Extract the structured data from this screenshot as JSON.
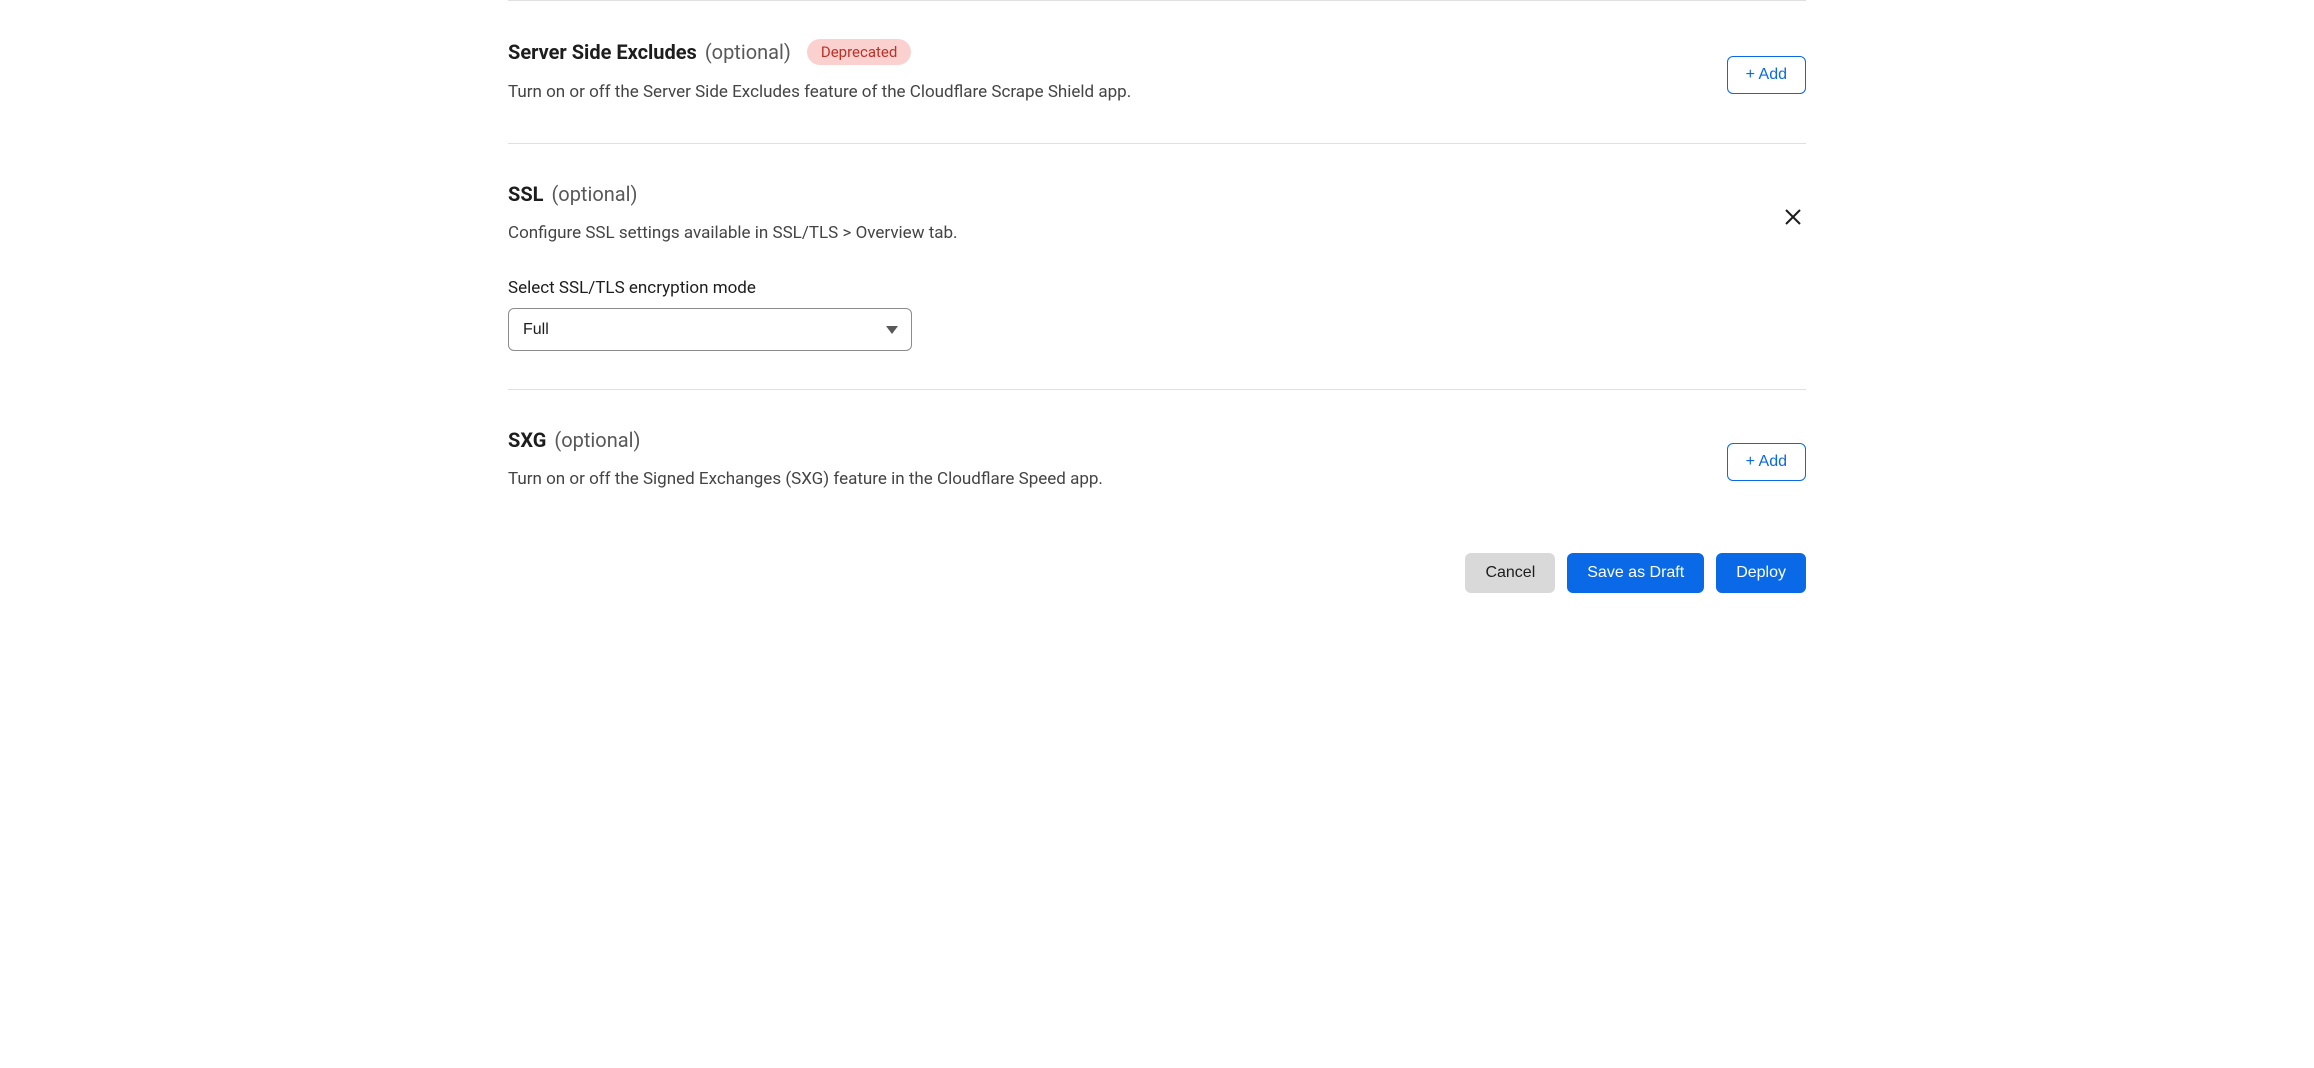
{
  "labels": {
    "optional": "(optional)",
    "add": "+ Add"
  },
  "sections": {
    "sse": {
      "title": "Server Side Excludes",
      "badge": "Deprecated",
      "description": "Turn on or off the Server Side Excludes feature of the Cloudflare Scrape Shield app."
    },
    "ssl": {
      "title": "SSL",
      "description": "Configure SSL settings available in SSL/TLS > Overview tab.",
      "field_label": "Select SSL/TLS encryption mode",
      "selected": "Full"
    },
    "sxg": {
      "title": "SXG",
      "description": "Turn on or off the Signed Exchanges (SXG) feature in the Cloudflare Speed app."
    }
  },
  "footer": {
    "cancel": "Cancel",
    "save_draft": "Save as Draft",
    "deploy": "Deploy"
  }
}
